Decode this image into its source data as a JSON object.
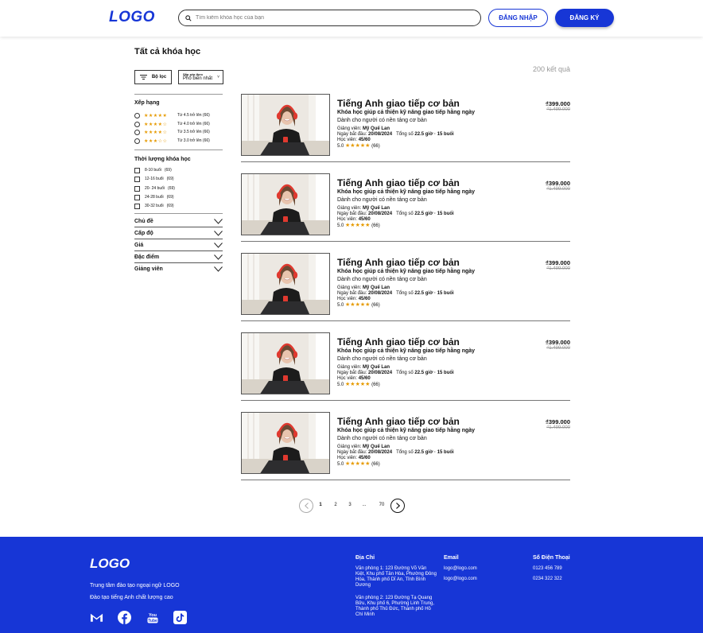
{
  "header": {
    "logo": "LOGO",
    "search_placeholder": "Tìm kiếm khóa học của bạn",
    "login_label": "ĐĂNG NHẬP",
    "register_label": "ĐĂNG KÝ"
  },
  "page": {
    "title": "Tất cả khóa học",
    "result_count": "200 kết quả"
  },
  "toolbar": {
    "filter_label": "Bộ lọc",
    "sort_caption": "Sắp xếp theo",
    "sort_value": "Phổ biến nhất"
  },
  "sidebar": {
    "rating_heading": "Xếp hạng",
    "ratings": [
      {
        "stars": "★★★★★",
        "label": "Từ 4.5 trở lên",
        "count": "(66)"
      },
      {
        "stars": "★★★★☆",
        "label": "Từ 4.0 trở lên",
        "count": "(66)"
      },
      {
        "stars": "★★★★☆",
        "label": "Từ 3.5 trở lên",
        "count": "(66)"
      },
      {
        "stars": "★★★☆☆",
        "label": "Từ 3.0 trở lên",
        "count": "(66)"
      }
    ],
    "duration_heading": "Thời lượng khóa học",
    "durations": [
      {
        "label": "8-10 buổi",
        "count": "(69)"
      },
      {
        "label": "12-16 buổi",
        "count": "(69)"
      },
      {
        "label": "20- 24 buổi",
        "count": "(69)"
      },
      {
        "label": "24-28 buổi",
        "count": "(69)"
      },
      {
        "label": "30-32 buổi",
        "count": "(69)"
      }
    ],
    "accordions": [
      "Chủ đề",
      "Cấp độ",
      "Giá",
      "Đặc điểm",
      "Giảng viên"
    ]
  },
  "course_labels": {
    "teacher_label": "Giảng viên:",
    "start_label": "Ngày bắt đầu:",
    "total_label": "Tổng số",
    "students_label": "Học viên:"
  },
  "courses": [
    {
      "title": "Tiếng Anh giao tiếp cơ bản",
      "subtitle": "Khóa học giúp cả thiện kỹ năng giao tiếp hằng ngày",
      "audience": "Dành cho người có nền tảng cơ bản",
      "teacher": "Mỹ Quế Lan",
      "start_date": "20/08/2024",
      "total": "22.5 giờ · 15 buổi",
      "students": "45/60",
      "rating": "5.0",
      "stars": "★★★★★",
      "reviews": "(66)",
      "price": "₫399.000",
      "old_price": "₫1.499.000"
    },
    {
      "title": "Tiếng Anh giao tiếp cơ bản",
      "subtitle": "Khóa học giúp cả thiện kỹ năng giao tiếp hằng ngày",
      "audience": "Dành cho người có nền tảng cơ bản",
      "teacher": "Mỹ Quế Lan",
      "start_date": "20/08/2024",
      "total": "22.5 giờ · 15 buổi",
      "students": "45/60",
      "rating": "5.0",
      "stars": "★★★★★",
      "reviews": "(66)",
      "price": "₫399.000",
      "old_price": "₫1.499.000"
    },
    {
      "title": "Tiếng Anh giao tiếp cơ bản",
      "subtitle": "Khóa học giúp cả thiện kỹ năng giao tiếp hằng ngày",
      "audience": "Dành cho người có nền tảng cơ bản",
      "teacher": "Mỹ Quế Lan",
      "start_date": "20/08/2024",
      "total": "22.5 giờ · 15 buổi",
      "students": "45/60",
      "rating": "5.0",
      "stars": "★★★★★",
      "reviews": "(66)",
      "price": "₫399.000",
      "old_price": "₫1.499.000"
    },
    {
      "title": "Tiếng Anh giao tiếp cơ bản",
      "subtitle": "Khóa học giúp cả thiện kỹ năng giao tiếp hằng ngày",
      "audience": "Dành cho người có nền tảng cơ bản",
      "teacher": "Mỹ Quế Lan",
      "start_date": "20/08/2024",
      "total": "22.5 giờ · 15 buổi",
      "students": "45/60",
      "rating": "5.0",
      "stars": "★★★★★",
      "reviews": "(66)",
      "price": "₫399.000",
      "old_price": "₫1.499.000"
    },
    {
      "title": "Tiếng Anh giao tiếp cơ bản",
      "subtitle": "Khóa học giúp cả thiện kỹ năng giao tiếp hằng ngày",
      "audience": "Dành cho người có nền tảng cơ bản",
      "teacher": "Mỹ Quế Lan",
      "start_date": "20/08/2024",
      "total": "22.5 giờ · 15 buổi",
      "students": "45/60",
      "rating": "5.0",
      "stars": "★★★★★",
      "reviews": "(66)",
      "price": "₫399.000",
      "old_price": "₫1.499.000"
    }
  ],
  "pagination": {
    "pages": [
      "1",
      "2",
      "3",
      "...",
      "70"
    ],
    "current": "1"
  },
  "footer": {
    "logo": "LOGO",
    "tagline1": "Trung tâm đào tạo ngoại ngữ LOGO",
    "tagline2": "Đào tạo tiếng Anh chất lượng cao",
    "address_heading": "Địa Chỉ",
    "address1": "Văn phòng 1: 123 Đường Võ Văn Kiệt, Khu phố Tân Hòa, Phường Đông Hòa, Thành phố Dĩ An, Tỉnh Bình Dương",
    "address2": "Văn phòng 2: 123 Đường Tạ Quang Bửu, Khu phố 6, Phường Linh Trung, Thành phố Thủ Đức, Thành phố Hồ Chí Minh",
    "email_heading": "Email",
    "email1": "logo@logo.com",
    "email2": "logo@logo.com",
    "phone_heading": "Số Điện Thoại",
    "phone1": "0123 456 789",
    "phone2": "0234 322 322",
    "socials": [
      "gmail-icon",
      "facebook-icon",
      "youtube-icon",
      "tiktok-icon"
    ]
  },
  "colors": {
    "brand": "#1736d6",
    "star": "#e69a00"
  }
}
